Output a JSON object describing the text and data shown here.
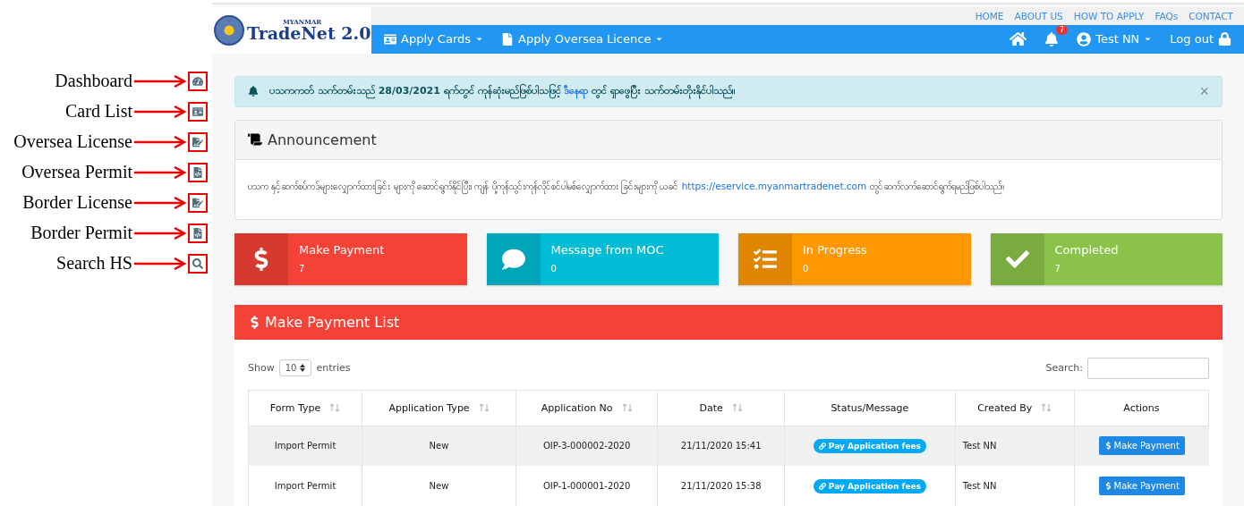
{
  "annotations": [
    {
      "label": "Dashboard"
    },
    {
      "label": "Card List"
    },
    {
      "label": "Oversea License"
    },
    {
      "label": "Oversea Permit"
    },
    {
      "label": "Border License"
    },
    {
      "label": "Border Permit"
    },
    {
      "label": "Search HS"
    }
  ],
  "logo": {
    "small": "MYANMAR",
    "name": "TradeNet 2.0"
  },
  "top_links": [
    "HOME",
    "ABOUT US",
    "HOW TO APPLY",
    "FAQs",
    "CONTACT"
  ],
  "nav": {
    "menus": [
      "Apply Cards",
      "Apply Oversea Licence"
    ],
    "notification_count": "7",
    "user": "Test NN",
    "logout": "Log out"
  },
  "alert": {
    "text_before": "ပသကကတ် သက်တမ်းသည် 28/03/2021 ရက်တွင် ကုန်ဆုံးမည်ဖြစ်ပါသဖြင့်",
    "link": "ဒီနေရာ",
    "text_after": "တွင် ရှာဖွေပြီး သက်တမ်းတိုးနိုင်ပါသည်။",
    "close": "×"
  },
  "announcement": {
    "title": "Announcement",
    "text_before": "ပသက နှင့်ဆက်စပ်ကဒ်များလျှောက်ထားခြင်း များကို ဆောင်ရွက်နိုင်ပြီး၊ ကျန် ပို့ကုန်သွင်းကုန်လိုင်စင်ပါမစ်လျှောက်ထား ခြင်းများကို ယခင်",
    "link": "https://eservice.myanmartradenet.com",
    "text_after": "တွင်ဆက်လက်ဆောင်ရွက်ရမည်ဖြစ်ပါသည်။"
  },
  "stats": [
    {
      "label": "Make Payment",
      "value": "7",
      "color": "#f44336"
    },
    {
      "label": "Message from MOC",
      "value": "0",
      "color": "#00bcd4"
    },
    {
      "label": "In Progress",
      "value": "0",
      "color": "#ff9800"
    },
    {
      "label": "Completed",
      "value": "7",
      "color": "#8bc34a"
    }
  ],
  "payment_list": {
    "title": "Make Payment List",
    "show_label": "Show",
    "page_size": "10",
    "entries_label": "entries",
    "search_label": "Search:",
    "columns": [
      {
        "label": "Form Type",
        "sortable": true
      },
      {
        "label": "Application Type",
        "sortable": true
      },
      {
        "label": "Application No",
        "sortable": true
      },
      {
        "label": "Date",
        "sortable": true
      },
      {
        "label": "Status/Message",
        "sortable": false
      },
      {
        "label": "Created By",
        "sortable": true
      },
      {
        "label": "Actions",
        "sortable": false
      }
    ],
    "rows": [
      {
        "cells": [
          "Import Permit",
          "New",
          "OIP-3-000002-2020",
          "21/11/2020 15:41"
        ],
        "status": "Pay Application fees",
        "created_by": "Test NN",
        "action": "Make Payment"
      },
      {
        "cells": [
          "Import Permit",
          "New",
          "OIP-1-000001-2020",
          "21/11/2020 15:38"
        ],
        "status": "Pay Application fees",
        "created_by": "Test NN",
        "action": "Make Payment"
      }
    ]
  }
}
